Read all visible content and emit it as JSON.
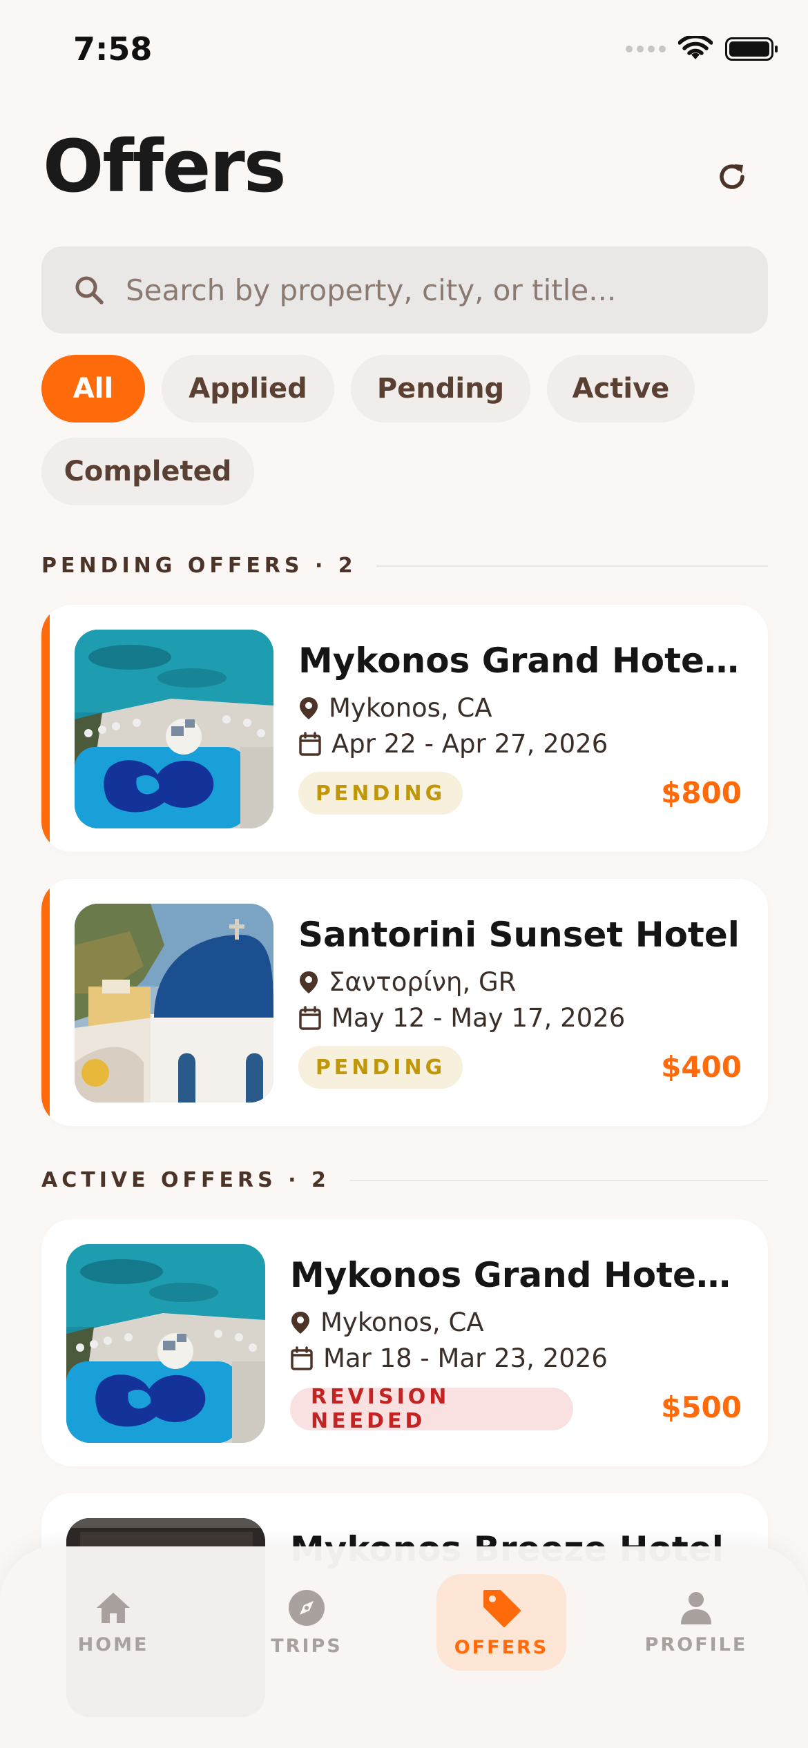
{
  "status_bar": {
    "time": "7:58"
  },
  "header": {
    "title": "Offers"
  },
  "search": {
    "placeholder": "Search by property, city, or title..."
  },
  "filters": [
    {
      "label": "All",
      "active": true
    },
    {
      "label": "Applied",
      "active": false
    },
    {
      "label": "Pending",
      "active": false
    },
    {
      "label": "Active",
      "active": false
    },
    {
      "label": "Completed",
      "active": false
    }
  ],
  "sections": [
    {
      "label": "PENDING OFFERS · 2",
      "offers": [
        {
          "title": "Mykonos Grand Hotel &...",
          "location": "Mykonos, CA",
          "dates": "Apr 22 - Apr 27, 2026",
          "status": "PENDING",
          "price": "$800"
        },
        {
          "title": "Santorini Sunset Hotel",
          "location": "Σαντορίνη, GR",
          "dates": "May 12 - May 17, 2026",
          "status": "PENDING",
          "price": "$400"
        }
      ]
    },
    {
      "label": "ACTIVE OFFERS · 2",
      "offers": [
        {
          "title": "Mykonos Grand Hotel &...",
          "location": "Mykonos, CA",
          "dates": "Mar 18 - Mar 23, 2026",
          "status": "REVISION NEEDED",
          "price": "$500"
        },
        {
          "title": "Mykonos Breeze Hotel"
        }
      ]
    }
  ],
  "tab_bar": [
    {
      "label": "HOME",
      "icon": "home-icon",
      "active": false
    },
    {
      "label": "TRIPS",
      "icon": "compass-icon",
      "active": false
    },
    {
      "label": "OFFERS",
      "icon": "tag-icon",
      "active": true
    },
    {
      "label": "PROFILE",
      "icon": "person-icon",
      "active": false
    }
  ],
  "colors": {
    "accent": "#ff6a0a",
    "pending_badge": "#c0960a",
    "revision_badge": "#c42323",
    "text_brown": "#4b3328"
  }
}
